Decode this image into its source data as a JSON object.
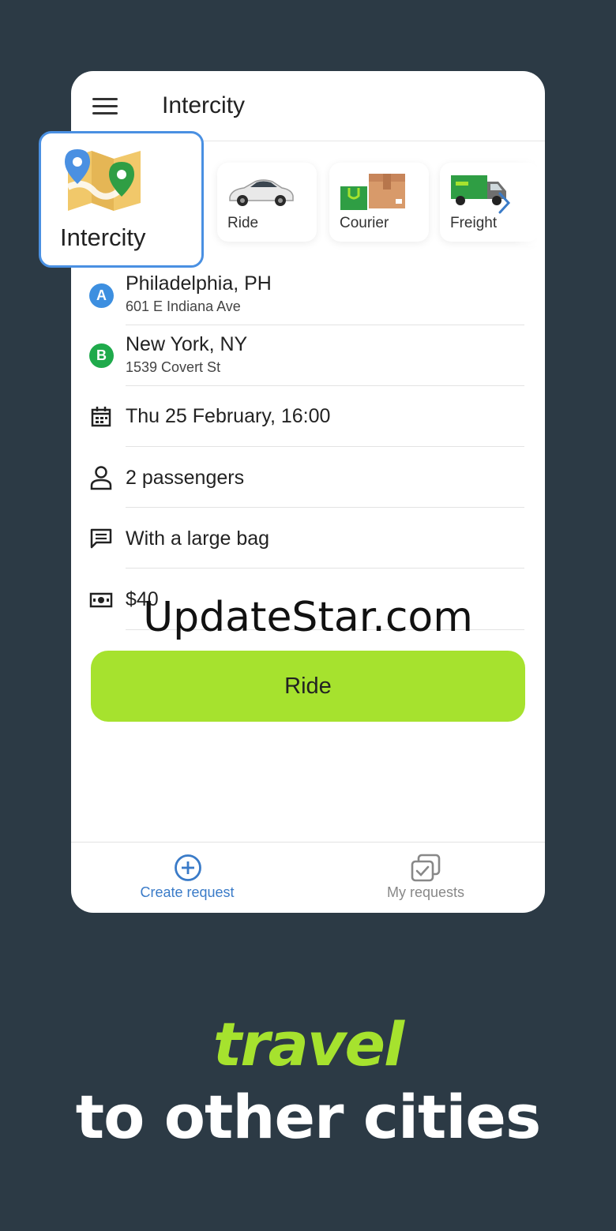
{
  "app": {
    "title": "Intercity"
  },
  "categories": [
    {
      "label": "Ride",
      "icon": "car-icon"
    },
    {
      "label": "Courier",
      "icon": "package-icon"
    },
    {
      "label": "Freight",
      "icon": "truck-icon"
    }
  ],
  "featured_category": {
    "label": "Intercity",
    "icon": "map-icon"
  },
  "route": {
    "from": {
      "badge": "A",
      "city": "Philadelphia, PH",
      "address": "601 E Indiana Ave",
      "color": "#3d8fe0"
    },
    "to": {
      "badge": "B",
      "city": "New York, NY",
      "address": "1539 Covert St",
      "color": "#1faa4b"
    }
  },
  "details": {
    "datetime": "Thu 25 February, 16:00",
    "passengers": "2 passengers",
    "comment": "With a large bag",
    "price": "$40"
  },
  "action": {
    "ride_label": "Ride",
    "color": "#a6e22e"
  },
  "bottom_nav": [
    {
      "label": "Create request",
      "icon": "plus-circle-icon",
      "active": true,
      "color": "#3a7bc8"
    },
    {
      "label": "My requests",
      "icon": "stacked-check-icon",
      "active": false,
      "color": "#888888"
    }
  ],
  "watermark": "UpdateStar.com",
  "promo": {
    "line1": "travel",
    "line2": "to other cities"
  }
}
